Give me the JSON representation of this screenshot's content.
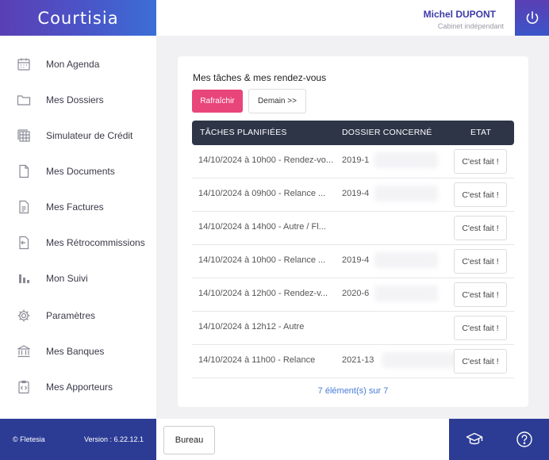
{
  "app": {
    "title": "Courtisia"
  },
  "header": {
    "user_name": "Michel DUPONT",
    "user_subtitle": "Cabinet indépendant"
  },
  "sidebar": {
    "items": [
      {
        "label": "Mon Agenda",
        "icon": "calendar-icon"
      },
      {
        "label": "Mes Dossiers",
        "icon": "folder-icon"
      },
      {
        "label": "Simulateur de Crédit",
        "icon": "table-icon"
      },
      {
        "label": "Mes Documents",
        "icon": "document-icon"
      },
      {
        "label": "Mes Factures",
        "icon": "invoice-icon"
      },
      {
        "label": "Mes Rétrocommissions",
        "icon": "commission-icon"
      },
      {
        "label": "Mon Suivi",
        "icon": "bar-chart-icon"
      },
      {
        "label": "Paramètres",
        "icon": "gear-icon"
      },
      {
        "label": "Mes Banques",
        "icon": "bank-icon"
      },
      {
        "label": "Mes Apporteurs",
        "icon": "code-file-icon"
      }
    ],
    "footer": {
      "copyright": "© Fletesia",
      "version": "Version : 6.22.12.1"
    }
  },
  "tasks": {
    "title": "Mes tâches & mes rendez-vous",
    "refresh_label": "Rafraîchir",
    "tomorrow_label": "Demain >>",
    "columns": [
      "TÂCHES PLANIFIÉES",
      "DOSSIER CONCERNÉ",
      "ETAT"
    ],
    "rows": [
      {
        "task": "14/10/2024 à 10h00 - Rendez-vo...",
        "dossier": "2019-1",
        "action": "C'est fait !"
      },
      {
        "task": "14/10/2024 à 09h00 - Relance ...",
        "dossier": "2019-4",
        "action": "C'est fait !"
      },
      {
        "task": "14/10/2024 à 14h00 - Autre / Fl...",
        "dossier": "",
        "action": "C'est fait !"
      },
      {
        "task": "14/10/2024 à 10h00 - Relance ...",
        "dossier": "2019-4",
        "action": "C'est fait !"
      },
      {
        "task": "14/10/2024 à 12h00 - Rendez-v...",
        "dossier": "2020-6",
        "action": "C'est fait !"
      },
      {
        "task": "14/10/2024 à 12h12 - Autre",
        "dossier": "",
        "action": "C'est fait !"
      },
      {
        "task": "14/10/2024 à 11h00 - Relance",
        "dossier": "2021-13",
        "action": "C'est fait !"
      }
    ],
    "summary": "7 élément(s) sur 7"
  },
  "bottom": {
    "bureau_label": "Bureau"
  },
  "colors": {
    "brand": "#4a55c8",
    "accent": "#e8457b",
    "footer": "#2c3c95",
    "table_header": "#2d3547"
  }
}
